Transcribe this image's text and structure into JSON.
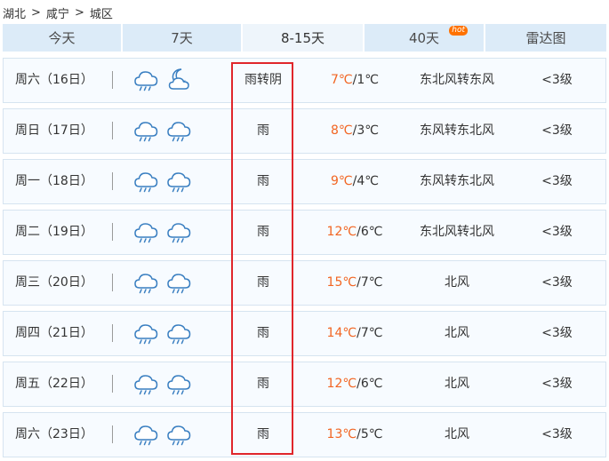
{
  "breadcrumb": {
    "province": "湖北",
    "city": "咸宁",
    "district": "城区",
    "separator": ">"
  },
  "tabs": [
    {
      "label": "今天"
    },
    {
      "label": "7天"
    },
    {
      "label": "8-15天",
      "active": true
    },
    {
      "label": "40天",
      "badge": "hot"
    },
    {
      "label": "雷达图"
    }
  ],
  "days": [
    {
      "date": "周六（16日）",
      "icon_day": "rain-cloud-icon",
      "icon_night": "moon-cloud-icon",
      "weather": "雨转阴",
      "high": "7℃",
      "low": "1℃",
      "wind": "东北风转东风",
      "level": "<3级"
    },
    {
      "date": "周日（17日）",
      "icon_day": "rain-cloud-icon",
      "icon_night": "rain-cloud-icon",
      "weather": "雨",
      "high": "8℃",
      "low": "3℃",
      "wind": "东风转东北风",
      "level": "<3级"
    },
    {
      "date": "周一（18日）",
      "icon_day": "rain-cloud-icon",
      "icon_night": "rain-cloud-icon",
      "weather": "雨",
      "high": "9℃",
      "low": "4℃",
      "wind": "东风转东北风",
      "level": "<3级"
    },
    {
      "date": "周二（19日）",
      "icon_day": "rain-cloud-icon",
      "icon_night": "rain-cloud-icon",
      "weather": "雨",
      "high": "12℃",
      "low": "6℃",
      "wind": "东北风转北风",
      "level": "<3级"
    },
    {
      "date": "周三（20日）",
      "icon_day": "rain-cloud-icon",
      "icon_night": "rain-cloud-icon",
      "weather": "雨",
      "high": "15℃",
      "low": "7℃",
      "wind": "北风",
      "level": "<3级"
    },
    {
      "date": "周四（21日）",
      "icon_day": "rain-cloud-icon",
      "icon_night": "rain-cloud-icon",
      "weather": "雨",
      "high": "14℃",
      "low": "7℃",
      "wind": "北风",
      "level": "<3级"
    },
    {
      "date": "周五（22日）",
      "icon_day": "rain-cloud-icon",
      "icon_night": "rain-cloud-icon",
      "weather": "雨",
      "high": "12℃",
      "low": "6℃",
      "wind": "北风",
      "level": "<3级"
    },
    {
      "date": "周六（23日）",
      "icon_day": "rain-cloud-icon",
      "icon_night": "rain-cloud-icon",
      "weather": "雨",
      "high": "13℃",
      "low": "5℃",
      "wind": "北风",
      "level": "<3级"
    }
  ],
  "temp_separator": "/",
  "colors": {
    "high_temp": "#f26522",
    "highlight_box": "#e0262b",
    "tab_bg": "#dcebf8",
    "icon_blue": "#3a7fc1"
  }
}
